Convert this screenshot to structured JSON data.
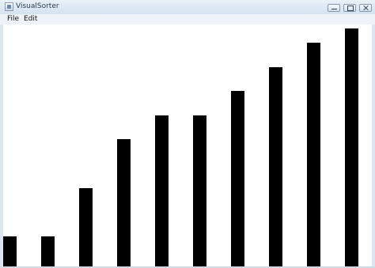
{
  "window": {
    "title": "VisualSorter",
    "controls": {
      "minimize_icon": "minimize-icon",
      "maximize_icon": "maximize-icon",
      "close_icon": "close-icon"
    }
  },
  "menu": {
    "items": [
      {
        "label": "File"
      },
      {
        "label": "Edit"
      }
    ]
  },
  "visualization": {
    "bar_color": "#000000",
    "background_color": "#ffffff",
    "scale_max": 10,
    "values": [
      1.25,
      1.25,
      3.25,
      5.25,
      6.25,
      6.25,
      7.25,
      8.25,
      9.25,
      9.85
    ]
  }
}
